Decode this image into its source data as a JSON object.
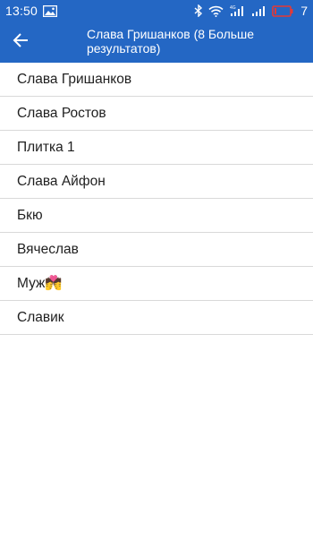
{
  "status_bar": {
    "time": "13:50",
    "battery_level": "7",
    "icons": [
      "image-notification-icon",
      "bluetooth-icon",
      "wifi-icon",
      "signal-4g-icon",
      "signal-icon",
      "battery-low-icon"
    ],
    "battery_color": "#e53935"
  },
  "app_bar": {
    "title": "Слава Гришанков (8 Больше результатов)",
    "back_icon": "arrow-back-icon",
    "background": "#2467c4"
  },
  "contacts": [
    {
      "name": "Слава Гришанков"
    },
    {
      "name": "Слава Ростов"
    },
    {
      "name": "Плитка 1"
    },
    {
      "name": "Слава Айфон"
    },
    {
      "name": "Бкю"
    },
    {
      "name": "Вячеслав"
    },
    {
      "name": "Муж💏"
    },
    {
      "name": "Славик"
    }
  ]
}
